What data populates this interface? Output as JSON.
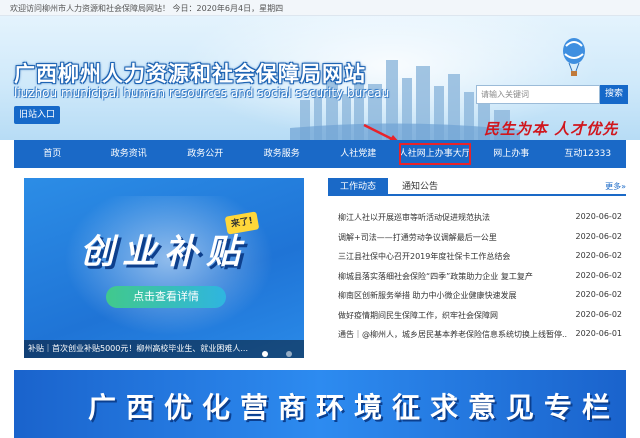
{
  "topbar": {
    "welcome": "欢迎访问柳州市人力资源和社会保障局网站！  今日：2020年6月4日，星期四"
  },
  "header": {
    "title": "广西柳州人力资源和社会保障局网站",
    "subtitle": "liuzhou municipal human resources and social security bureau",
    "old_site": "旧站入口",
    "search_placeholder": "请输入关键词",
    "search_button": "搜索",
    "slogan": "民生为本 人才优先"
  },
  "nav": {
    "items": [
      "首页",
      "政务资讯",
      "政务公开",
      "政务服务",
      "人社党建",
      "人社网上办事大厅",
      "网上办事",
      "互动12333"
    ],
    "highlighted_index": 5
  },
  "banner": {
    "title": "创业补贴",
    "tag": "来了!",
    "button": "点击查看详情",
    "caption": "补贴｜首次创业补贴5000元！柳州高校毕业生、就业困难人..."
  },
  "news": {
    "tab_active": "工作动态",
    "tab_inactive": "通知公告",
    "more": "更多»",
    "rows": [
      {
        "title": "柳江人社以开展巡审等听活动促进规范执法",
        "date": "2020-06-02"
      },
      {
        "title": "调解+司法——打通劳动争议调解最后一公里",
        "date": "2020-06-02"
      },
      {
        "title": "三江县社保中心召开2019年度社保卡工作总结会",
        "date": "2020-06-02"
      },
      {
        "title": "柳城县落实落细社会保险“四季”政策助力企业 复工复产",
        "date": "2020-06-02"
      },
      {
        "title": "柳南区创新服务举措 助力中小微企业健康快速发展",
        "date": "2020-06-02"
      },
      {
        "title": "做好疫情期间民生保障工作，织牢社会保障网",
        "date": "2020-06-02"
      },
      {
        "title": "通告｜@柳州人，城乡居民基本养老保险信息系统切换上线暂停...",
        "date": "2020-06-01"
      }
    ]
  },
  "promo": {
    "text": "广西优化营商环境征求意见专栏"
  },
  "colors": {
    "primary": "#1a69c7",
    "highlight_border": "#e8232a",
    "slogan": "#d0161d"
  }
}
